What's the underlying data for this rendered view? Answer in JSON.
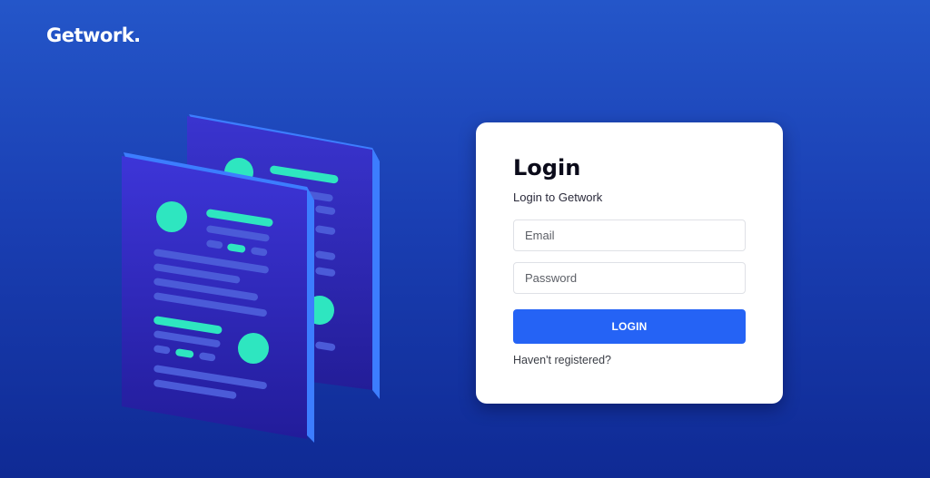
{
  "brand": {
    "name": "Getwork."
  },
  "illustration": {
    "icon": "documents-illustration"
  },
  "login": {
    "title": "Login",
    "subtitle": "Login to Getwork",
    "email_placeholder": "Email",
    "password_placeholder": "Password",
    "button_label": "LOGIN",
    "register_link": "Haven't registered?"
  },
  "colors": {
    "background_top": "#2456c9",
    "background_bottom": "#0f2a94",
    "accent_button": "#2563f5",
    "illustration_teal": "#2ee6c0",
    "illustration_page": "#3b2fd6"
  }
}
